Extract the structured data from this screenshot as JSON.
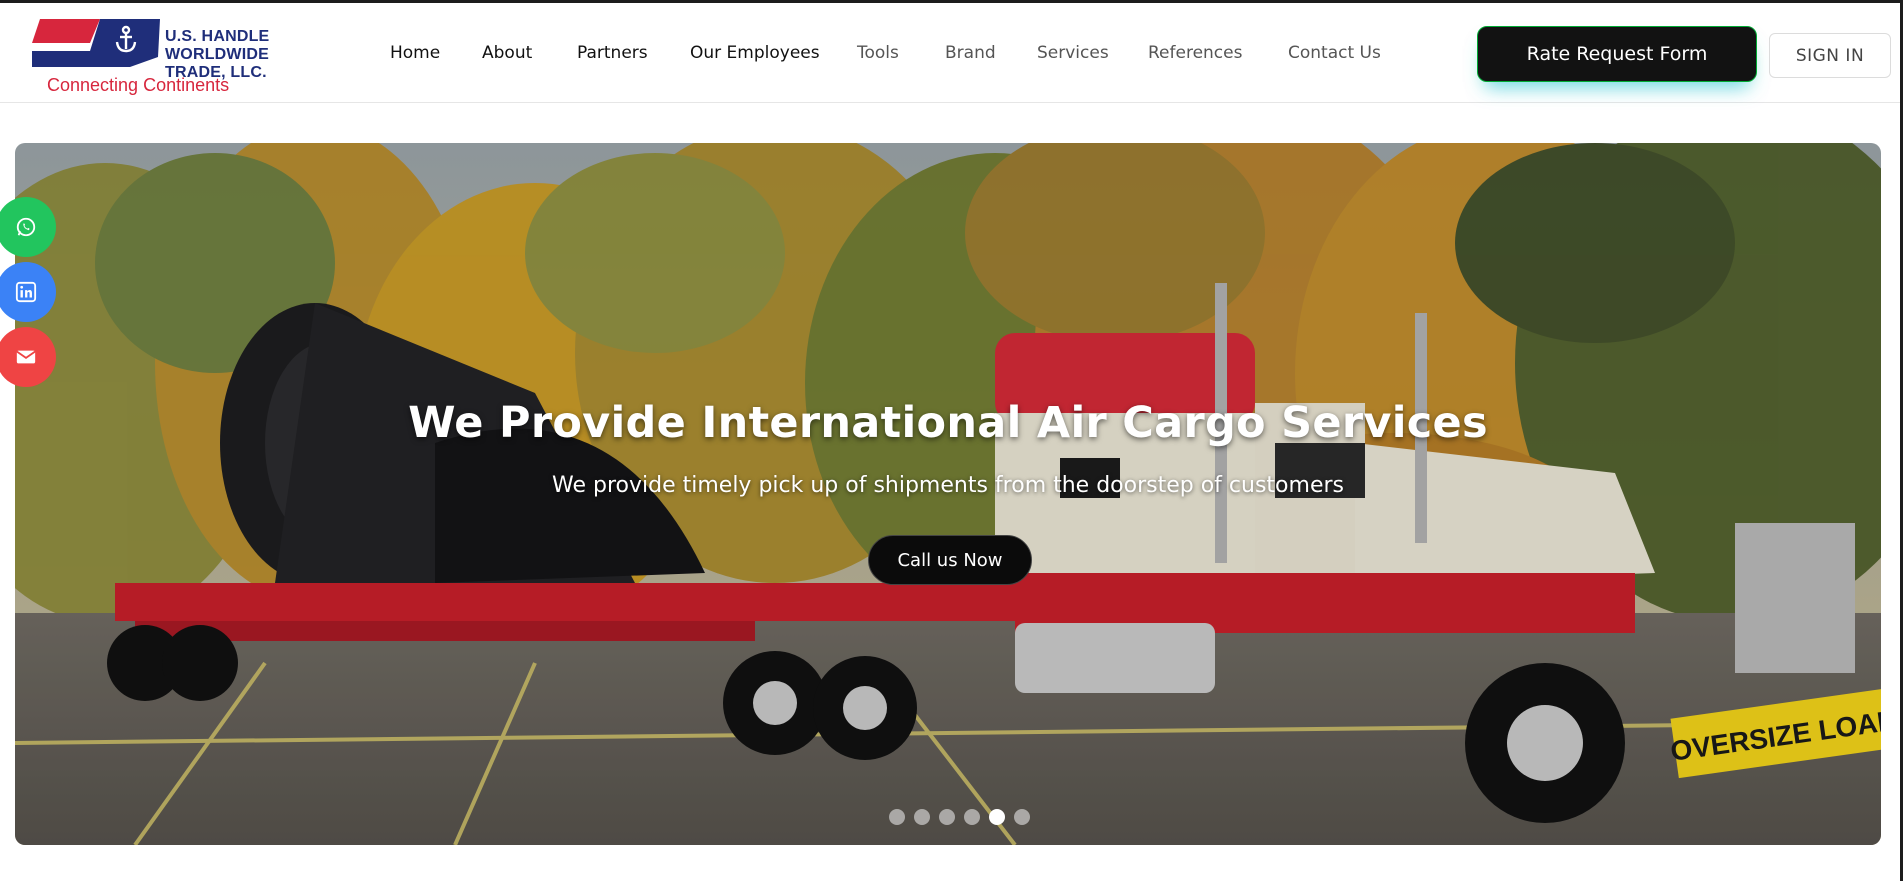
{
  "logo": {
    "lines": [
      "U.S. HANDLE",
      "WORLDWIDE",
      "TRADE, LLC."
    ],
    "tagline": "Connecting Continents"
  },
  "nav": {
    "items": [
      {
        "label": "Home"
      },
      {
        "label": "About"
      },
      {
        "label": "Partners"
      },
      {
        "label": "Our Employees"
      },
      {
        "label": "Tools"
      },
      {
        "label": "Brand"
      },
      {
        "label": "Services"
      },
      {
        "label": "References"
      },
      {
        "label": "Contact Us"
      }
    ],
    "rate_request_label": "Rate Request Form",
    "signin_label": "SIGN IN"
  },
  "hero": {
    "title": "We Provide International Air Cargo Services",
    "subtitle": "We provide timely pick up of shipments from the doorstep of customers",
    "cta_label": "Call us Now",
    "slide_count": 6,
    "active_slide": 5,
    "truck_bumper_text": "OVERSIZE LOAD"
  },
  "social": {
    "icons": [
      "whatsapp-icon",
      "linkedin-icon",
      "email-icon"
    ],
    "colors": {
      "whatsapp": "#22c55e",
      "linkedin": "#3b82f6",
      "email": "#ef4444"
    }
  },
  "colors": {
    "brand_blue": "#1f2e7a",
    "brand_red": "#d7263d",
    "button_dark": "#121212"
  }
}
